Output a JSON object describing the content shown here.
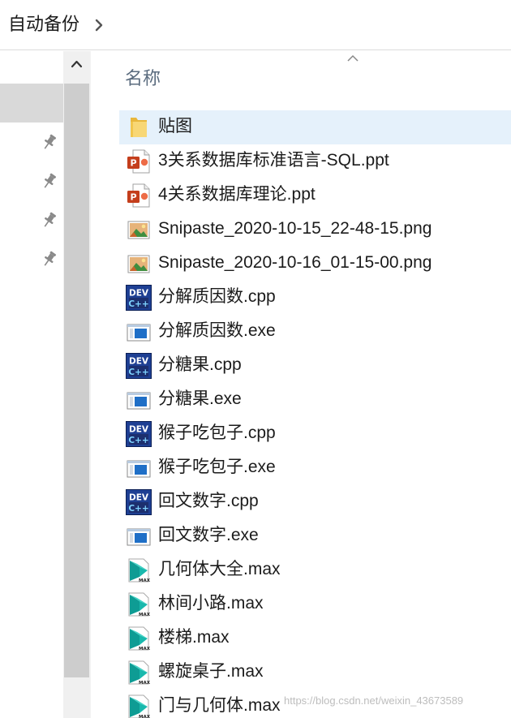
{
  "address_bar": {
    "breadcrumb": "自动备份"
  },
  "content": {
    "column_header": "名称",
    "files": [
      {
        "name": "贴图",
        "icon": "folder-icon",
        "selected": true
      },
      {
        "name": "3关系数据库标准语言-SQL.ppt",
        "icon": "powerpoint-icon"
      },
      {
        "name": "4关系数据库理论.ppt",
        "icon": "powerpoint-icon"
      },
      {
        "name": "Snipaste_2020-10-15_22-48-15.png",
        "icon": "image-icon"
      },
      {
        "name": "Snipaste_2020-10-16_01-15-00.png",
        "icon": "image-icon"
      },
      {
        "name": "分解质因数.cpp",
        "icon": "devcpp-icon"
      },
      {
        "name": "分解质因数.exe",
        "icon": "exe-icon"
      },
      {
        "name": "分糖果.cpp",
        "icon": "devcpp-icon"
      },
      {
        "name": "分糖果.exe",
        "icon": "exe-icon"
      },
      {
        "name": "猴子吃包子.cpp",
        "icon": "devcpp-icon"
      },
      {
        "name": "猴子吃包子.exe",
        "icon": "exe-icon"
      },
      {
        "name": "回文数字.cpp",
        "icon": "devcpp-icon"
      },
      {
        "name": "回文数字.exe",
        "icon": "exe-icon"
      },
      {
        "name": "几何体大全.max",
        "icon": "3dsmax-icon"
      },
      {
        "name": "林间小路.max",
        "icon": "3dsmax-icon"
      },
      {
        "name": "楼梯.max",
        "icon": "3dsmax-icon"
      },
      {
        "name": "螺旋桌子.max",
        "icon": "3dsmax-icon"
      },
      {
        "name": "门与几何体.max",
        "icon": "3dsmax-icon"
      }
    ]
  },
  "icon_labels": {
    "devcpp_top": "DEV",
    "devcpp_bottom": "C++",
    "max_label": "MAX"
  },
  "watermark": "https://blog.csdn.net/weixin_43673589",
  "colors": {
    "selected_row": "#e5f1fb",
    "header_text": "#5a6b7e",
    "scroll_thumb": "#cdcdcd"
  }
}
